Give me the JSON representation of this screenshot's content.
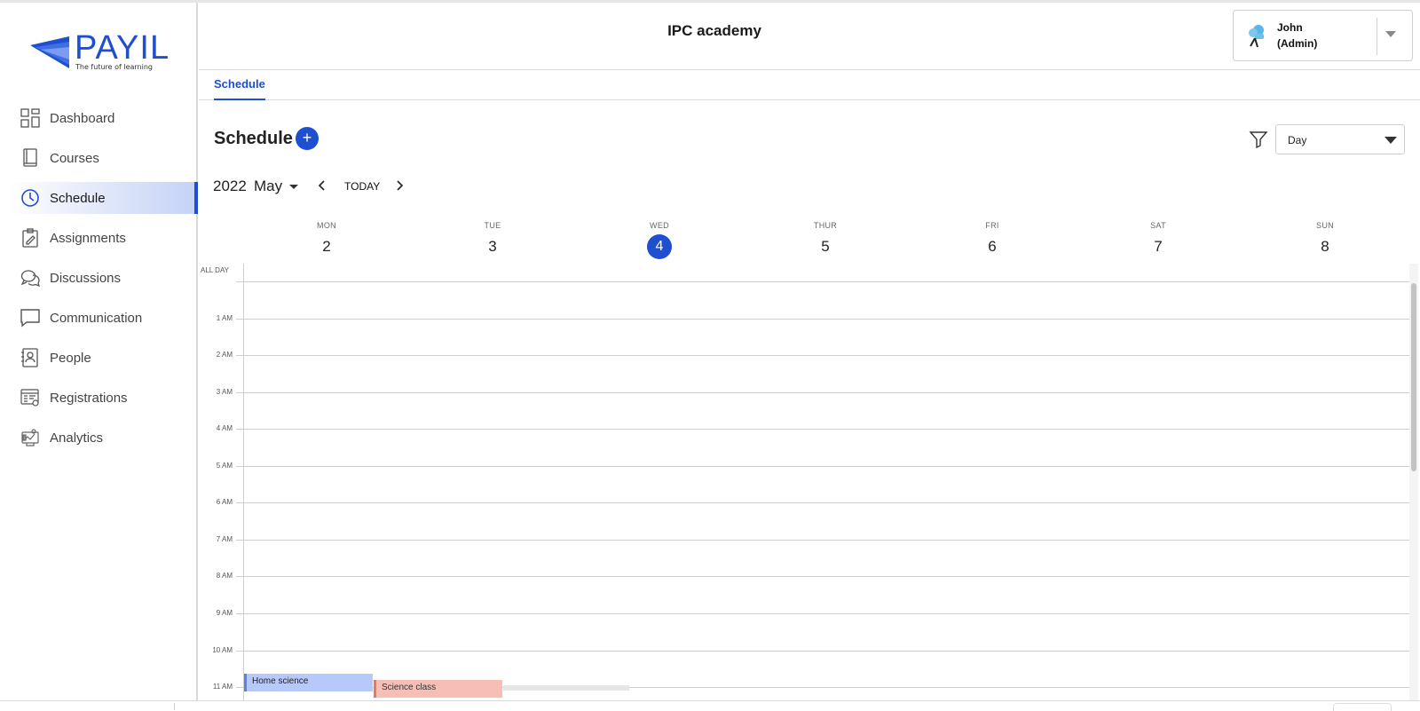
{
  "brand": {
    "name": "PAYIL",
    "tagline": "The future of learning",
    "color": "#1f4fd1"
  },
  "sidebar": {
    "items": [
      {
        "label": "Dashboard",
        "icon": "dashboard-icon"
      },
      {
        "label": "Courses",
        "icon": "book-icon"
      },
      {
        "label": "Schedule",
        "icon": "clock-icon",
        "active": true
      },
      {
        "label": "Assignments",
        "icon": "clipboard-pencil-icon"
      },
      {
        "label": "Discussions",
        "icon": "chat-bubbles-icon"
      },
      {
        "label": "Communication",
        "icon": "message-square-icon"
      },
      {
        "label": "People",
        "icon": "contact-book-icon"
      },
      {
        "label": "Registrations",
        "icon": "registration-form-icon"
      },
      {
        "label": "Analytics",
        "icon": "analytics-icon"
      }
    ]
  },
  "header": {
    "title": "IPC academy",
    "user": {
      "name": "John",
      "role": "(Admin)"
    }
  },
  "tabs": [
    {
      "label": "Schedule",
      "active": true
    }
  ],
  "schedule": {
    "title": "Schedule",
    "add_label": "+",
    "view": "Day",
    "year": "2022",
    "month": "May",
    "today_label": "TODAY",
    "days": [
      {
        "name": "MON",
        "num": "2"
      },
      {
        "name": "TUE",
        "num": "3"
      },
      {
        "name": "WED",
        "num": "4",
        "current": true
      },
      {
        "name": "THUR",
        "num": "5"
      },
      {
        "name": "FRI",
        "num": "6"
      },
      {
        "name": "SAT",
        "num": "7"
      },
      {
        "name": "SUN",
        "num": "8"
      }
    ],
    "all_day_label": "ALL DAY",
    "hours": [
      "1 AM",
      "2 AM",
      "3 AM",
      "4 AM",
      "5 AM",
      "6 AM",
      "7 AM",
      "8 AM",
      "9 AM",
      "10 AM",
      "11 AM"
    ],
    "events": [
      {
        "title": "Home science",
        "day": "MON",
        "color": "#b7c8fb"
      },
      {
        "title": "Science class",
        "day": "TUE",
        "color": "#f7beb5"
      }
    ]
  }
}
